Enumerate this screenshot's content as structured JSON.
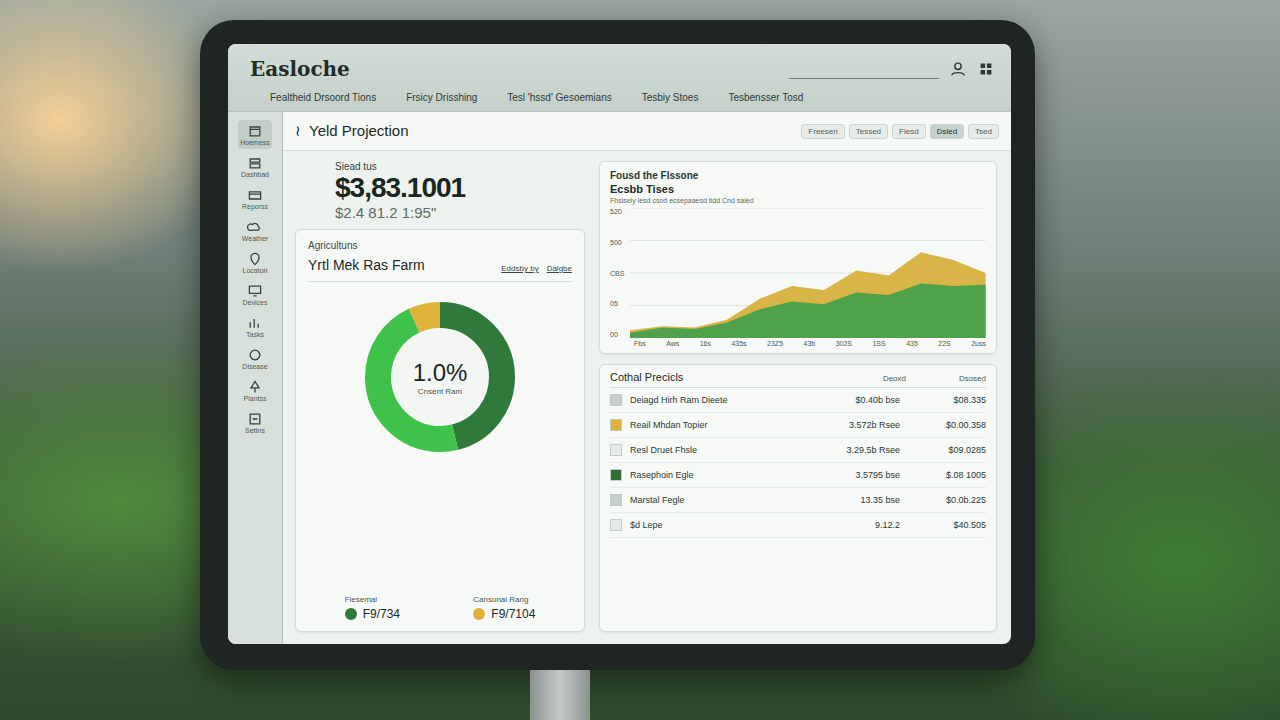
{
  "app": {
    "logo": "Easloche",
    "nav": [
      "Fealtheid Drsoord Tions",
      "Frsicy Drisshing",
      "Tesl 'hssd' Gesoemians",
      "Tesbiy Stoes",
      "Tesbensser Tosd"
    ]
  },
  "sidebar": {
    "items": [
      {
        "label": "Hoemess",
        "selected": true
      },
      {
        "label": "Dashbad",
        "selected": false
      },
      {
        "label": "Reporss",
        "selected": false
      },
      {
        "label": "Weather",
        "selected": false
      },
      {
        "label": "Locaton",
        "selected": false
      },
      {
        "label": "Devices",
        "selected": false
      },
      {
        "label": "Tasks",
        "selected": false
      },
      {
        "label": "Disease",
        "selected": false
      },
      {
        "label": "Plantss",
        "selected": false
      },
      {
        "label": "Settns",
        "selected": false
      }
    ]
  },
  "page": {
    "title": "Yeld Projection",
    "filters": [
      {
        "label": "Freesen",
        "selected": false
      },
      {
        "label": "Tessed",
        "selected": false
      },
      {
        "label": "Fiesd",
        "selected": false
      },
      {
        "label": "Dsled",
        "selected": true
      },
      {
        "label": "Tsed",
        "selected": false
      }
    ]
  },
  "summary": {
    "label": "Siead tus",
    "value": "$3,83.1001",
    "sub": "$2.4 81.2 1:95\""
  },
  "farm_card": {
    "eyebrow": "Agricultuns",
    "title": "Yrtl Mek Ras Farm",
    "links": [
      "Eddsby by",
      "Dalgbe"
    ],
    "donut": {
      "value": "1.0%",
      "caption": "Cnsent Ram",
      "segments": [
        {
          "level": 0.46,
          "color": "#2f7a3a"
        },
        {
          "level": 0.47,
          "color": "#3fc24a"
        },
        {
          "level": 0.07,
          "color": "#e0b23a"
        }
      ]
    },
    "legend": [
      {
        "label": "Fiesemal",
        "value": "F9/734",
        "color": "#2f7a3a"
      },
      {
        "label": "Cansunal Rang",
        "value": "F9/7104",
        "color": "#e0b23a"
      }
    ]
  },
  "chart": {
    "eyebrow": "Fousd the Flssone",
    "title": "Ecsbb Tises",
    "subtitle": "Fhsisely lesd csod ecsepaaesd tidd Cnd saied",
    "y_ticks": [
      "520",
      "500",
      "CBS",
      "05",
      "00"
    ],
    "x_ticks": [
      "Fbs",
      "Aws",
      "16s",
      "435s",
      "23Z5",
      "43b",
      "302S",
      "1SS",
      "435",
      "22S",
      "2uss"
    ],
    "series": [
      {
        "name": "yellow",
        "color": "#d9b548",
        "values": [
          30,
          45,
          40,
          70,
          150,
          200,
          185,
          260,
          240,
          330,
          300,
          250
        ]
      },
      {
        "name": "green",
        "color": "#4fa24a",
        "values": [
          20,
          40,
          35,
          60,
          110,
          140,
          130,
          175,
          165,
          210,
          200,
          205
        ]
      }
    ]
  },
  "table": {
    "title": "Cothal Precicls",
    "columns": [
      "Deoxd",
      "Dsosed"
    ],
    "rows": [
      {
        "name": "Deiagd Hirh Ram Dieete",
        "a": "$0.40b bse",
        "b": "$08.335",
        "color": "#c9d3cd"
      },
      {
        "name": "Reail Mhdan Topier",
        "a": "3.572b Rsee",
        "b": "$0.00.358",
        "color": "#e0b23a"
      },
      {
        "name": "Resl Druet Fhsle",
        "a": "3.29.5b Rsee",
        "b": "$09.0285",
        "color": "#e7ece8"
      },
      {
        "name": "Rasephoin Egle",
        "a": "3.5795 bse",
        "b": "$.08 1005",
        "color": "#2f6b33"
      },
      {
        "name": "Marstal Fegle",
        "a": "13.35 bse",
        "b": "$0.0b.225",
        "color": "#c9d3cd"
      },
      {
        "name": "$d Lepe",
        "a": "9.12.2",
        "b": "$40.505",
        "color": "#e7ece8"
      }
    ]
  }
}
